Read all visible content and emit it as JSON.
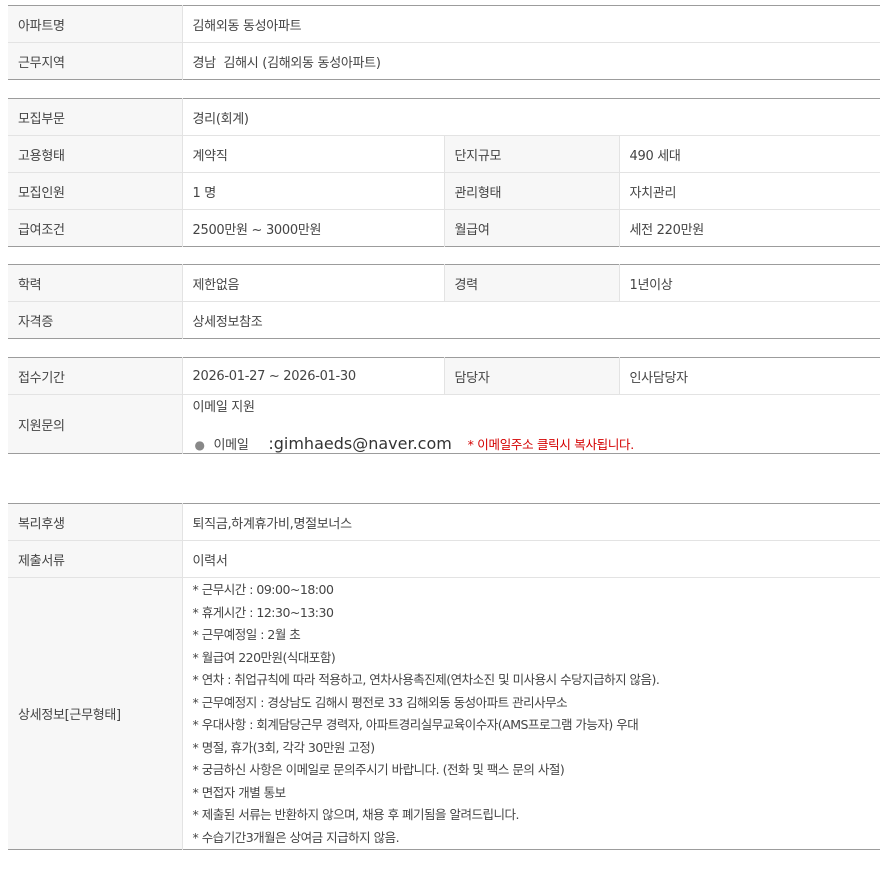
{
  "group1": {
    "apt_name_label": "아파트명",
    "apt_name": "김해외동 동성아파트",
    "region_label": "근무지역",
    "region": "경남  김해시 (김해외동 동성아파트)"
  },
  "group2": {
    "dept_label": "모집부문",
    "dept": "경리(회계)",
    "employ_type_label": "고용형태",
    "employ_type": "계약직",
    "complex_size_label": "단지규모",
    "complex_size": "490 세대",
    "headcount_label": "모집인원",
    "headcount": "1 명",
    "mgmt_type_label": "관리형태",
    "mgmt_type": "자치관리",
    "salary_label": "급여조건",
    "salary": "2500만원 ~ 3000만원",
    "monthly_label": "월급여",
    "monthly": "세전 220만원"
  },
  "group3": {
    "edu_label": "학력",
    "edu": "제한없음",
    "career_label": "경력",
    "career": "1년이상",
    "license_label": "자격증",
    "license": "상세정보참조"
  },
  "group4": {
    "period_label": "접수기간",
    "period": "2026-01-27 ~ 2026-01-30",
    "contact_label": "담당자",
    "contact": "인사담당자",
    "inquiry_label": "지원문의",
    "inquiry_method": "이메일 지원",
    "email_label": "이메일",
    "email": ":gimhaeds@naver.com",
    "email_note": "* 이메일주소 클릭시 복사됩니다."
  },
  "group5": {
    "welfare_label": "복리후생",
    "welfare": "퇴직금,하계휴가비,명절보너스",
    "docs_label": "제출서류",
    "docs": "이력서",
    "detail_label": "상세정보[근무형태]",
    "details": [
      "* 근무시간 : 09:00~18:00",
      "* 휴게시간 : 12:30~13:30",
      "* 근무예정일 : 2월 초",
      "* 월급여 220만원(식대포함)",
      "* 연차 : 취업규칙에 따라 적용하고, 연차사용촉진제(연차소진 및 미사용시 수당지급하지 않음).",
      "* 근무예정지 : 경상남도 김해시 평전로 33 김해외동 동성아파트 관리사무소",
      "* 우대사항 : 회계담당근무 경력자, 아파트경리실무교육이수자(AMS프로그램 가능자) 우대",
      "* 명절, 휴가(3회, 각각 30만원 고정)",
      "* 궁금하신 사항은 이메일로 문의주시기 바랍니다. (전화 및 팩스 문의 사절)",
      "* 면접자 개별 통보",
      "* 제출된 서류는 반환하지 않으며, 채용 후 폐기됨을 알려드립니다.",
      "* 수습기간3개월은 상여금 지급하지 않음."
    ]
  }
}
